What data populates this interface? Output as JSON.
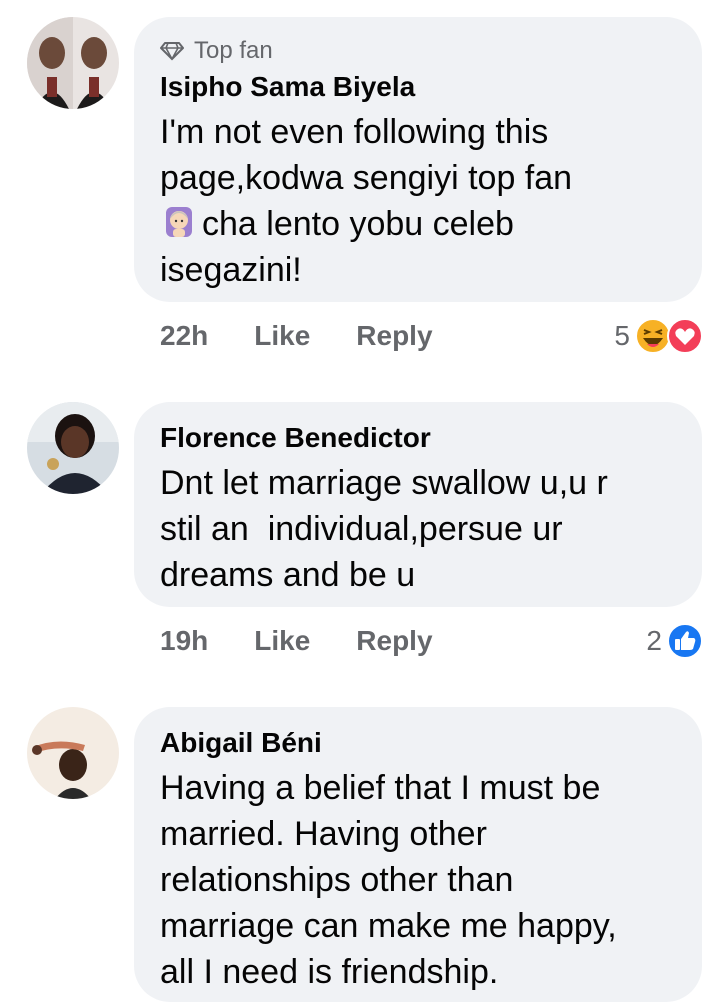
{
  "comments": [
    {
      "badge": "Top fan",
      "author": "Isipho Sama Biyela",
      "text_line1": "I'm not even following this",
      "text_line2": "page,kodwa sengiyi top fan",
      "text_line3": "cha lento yobu celeb",
      "text_line4": "isegazini!",
      "time": "22h",
      "like_label": "Like",
      "reply_label": "Reply",
      "reaction_count": "5",
      "reactions": [
        "haha-icon",
        "love-icon"
      ]
    },
    {
      "author": "Florence Benedictor",
      "text_line1": "Dnt let marriage swallow u,u r",
      "text_line2": "stil an  individual,persue ur",
      "text_line3": "dreams and be u",
      "time": "19h",
      "like_label": "Like",
      "reply_label": "Reply",
      "reaction_count": "2",
      "reactions": [
        "like-icon"
      ]
    },
    {
      "author": "Abigail Béni",
      "text_line1": "Having a belief that I must be",
      "text_line2": "married. Having other",
      "text_line3": "relationships other than",
      "text_line4": "marriage can make me happy,",
      "text_line5": "all I need is friendship."
    }
  ],
  "colors": {
    "bubble": "#f0f2f5",
    "meta_text": "#65676b",
    "like_blue": "#1877f2",
    "love_red": "#f33e58",
    "haha_yellow": "#f7b125"
  }
}
